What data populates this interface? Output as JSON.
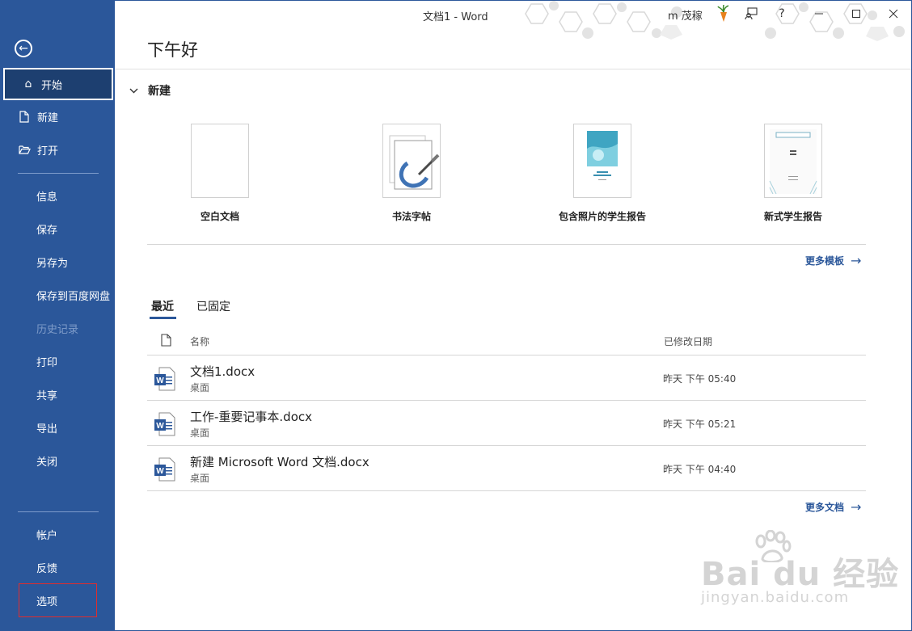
{
  "window": {
    "title": "文档1 - Word",
    "user": "m 茂稼",
    "help_label": "?"
  },
  "sidebar": {
    "primary": [
      {
        "id": "home",
        "label": "开始",
        "icon": "home-icon"
      },
      {
        "id": "new",
        "label": "新建",
        "icon": "new-document-icon"
      },
      {
        "id": "open",
        "label": "打开",
        "icon": "folder-open-icon"
      }
    ],
    "middle": [
      {
        "id": "info",
        "label": "信息"
      },
      {
        "id": "save",
        "label": "保存"
      },
      {
        "id": "save-as",
        "label": "另存为"
      },
      {
        "id": "save-baidu",
        "label": "保存到百度网盘"
      },
      {
        "id": "history",
        "label": "历史记录"
      },
      {
        "id": "print",
        "label": "打印"
      },
      {
        "id": "share",
        "label": "共享"
      },
      {
        "id": "export",
        "label": "导出"
      },
      {
        "id": "close",
        "label": "关闭"
      }
    ],
    "bottom": [
      {
        "id": "account",
        "label": "帐户"
      },
      {
        "id": "feedback",
        "label": "反馈"
      },
      {
        "id": "options",
        "label": "选项"
      }
    ]
  },
  "main": {
    "greeting": "下午好",
    "new_section": {
      "title": "新建",
      "templates": [
        {
          "name": "空白文档"
        },
        {
          "name": "书法字帖"
        },
        {
          "name": "包含照片的学生报告"
        },
        {
          "name": "新式学生报告"
        }
      ],
      "more_label": "更多模板"
    },
    "tabs": [
      {
        "label": "最近",
        "active": true
      },
      {
        "label": "已固定",
        "active": false
      }
    ],
    "columns": {
      "name": "名称",
      "modified": "已修改日期"
    },
    "files": [
      {
        "name": "文档1.docx",
        "location": "桌面",
        "modified": "昨天 下午 05:40"
      },
      {
        "name": "工作-重要记事本.docx",
        "location": "桌面",
        "modified": "昨天 下午 05:21"
      },
      {
        "name": "新建 Microsoft Word 文档.docx",
        "location": "桌面",
        "modified": "昨天 下午 04:40"
      }
    ],
    "more_docs_label": "更多文档"
  },
  "watermark": {
    "brand": "Bai du 经验",
    "url": "jingyan.baidu.com"
  },
  "colors": {
    "accent": "#2b579a",
    "accent_dark": "#1d3f70",
    "highlight_box": "#e02d2d"
  }
}
